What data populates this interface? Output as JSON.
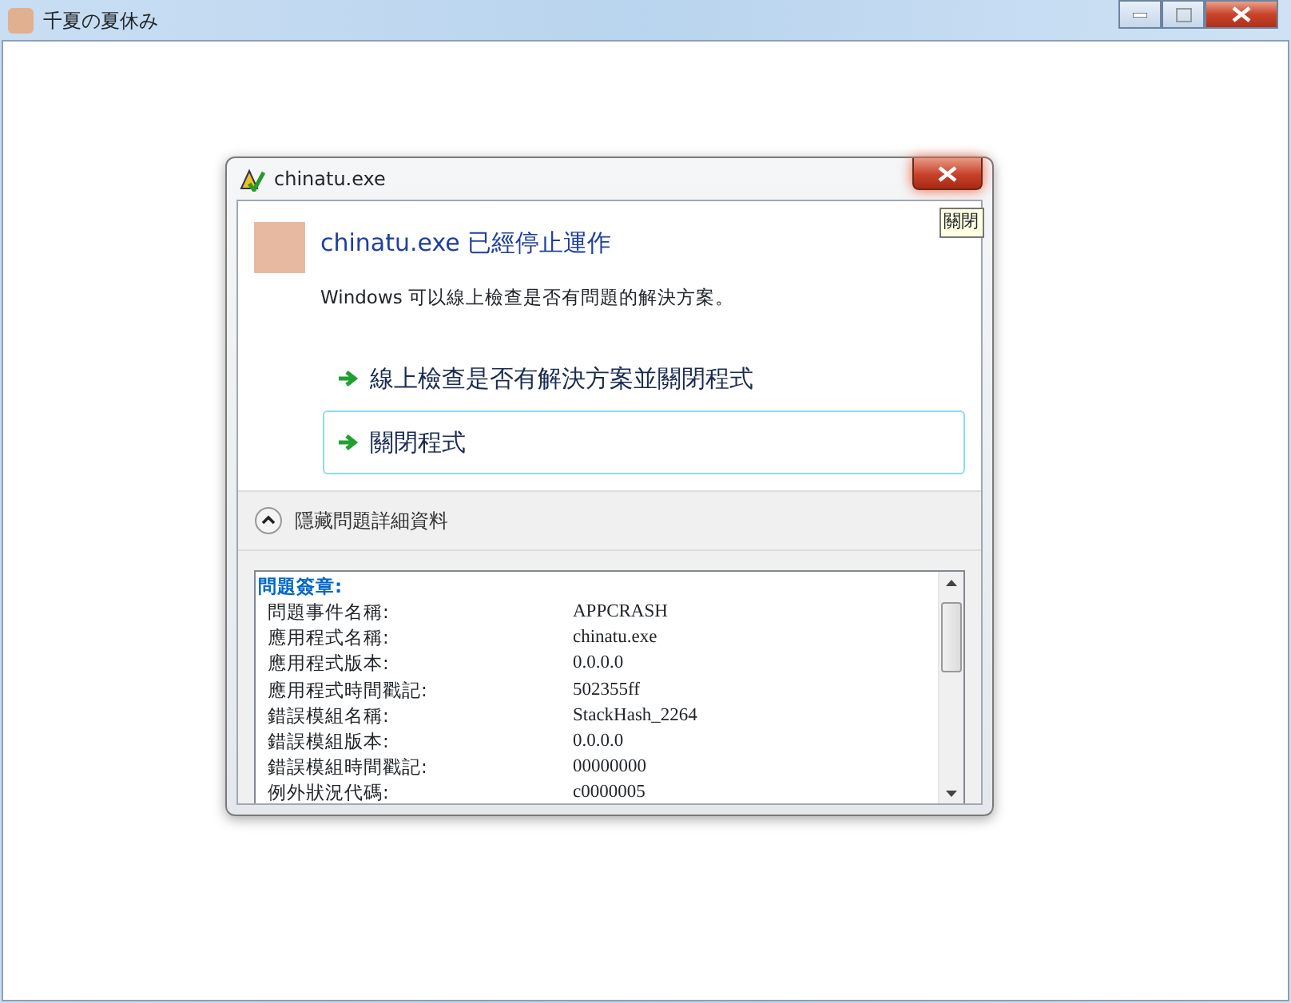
{
  "window": {
    "title": "千夏の夏休み"
  },
  "dialog": {
    "title": "chinatu.exe",
    "tooltip": "關閉",
    "heading": "chinatu.exe 已經停止運作",
    "message": "Windows 可以線上檢查是否有問題的解決方案。",
    "options": [
      {
        "label": "線上檢查是否有解決方案並關閉程式",
        "selected": false
      },
      {
        "label": "關閉程式",
        "selected": true
      }
    ],
    "details_toggle": {
      "label": "隱藏問題詳細資料",
      "expanded": true
    },
    "details": {
      "heading": "問題簽章:",
      "rows": [
        {
          "name": "問題事件名稱:",
          "value": "APPCRASH"
        },
        {
          "name": "應用程式名稱:",
          "value": "chinatu.exe"
        },
        {
          "name": "應用程式版本:",
          "value": "0.0.0.0"
        },
        {
          "name": "應用程式時間戳記:",
          "value": "502355ff"
        },
        {
          "name": "錯誤模組名稱:",
          "value": "StackHash_2264"
        },
        {
          "name": "錯誤模組版本:",
          "value": "0.0.0.0"
        },
        {
          "name": "錯誤模組時間戳記:",
          "value": "00000000"
        },
        {
          "name": "例外狀況代碼:",
          "value": "c0000005"
        }
      ]
    }
  }
}
